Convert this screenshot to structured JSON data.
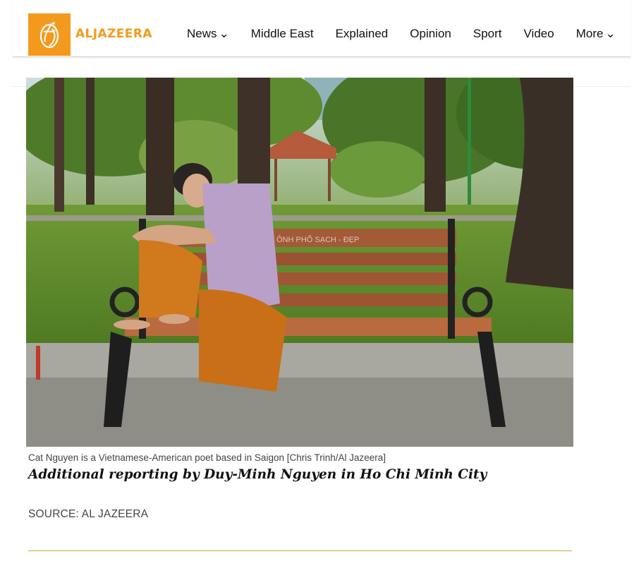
{
  "header": {
    "logo_text": "ALJAZEERA",
    "logo_icon": "aljazeera-calligraphy-icon",
    "brand_color": "#f39a1e",
    "nav": [
      {
        "label": "News",
        "has_dropdown": true
      },
      {
        "label": "Middle East",
        "has_dropdown": false
      },
      {
        "label": "Explained",
        "has_dropdown": false
      },
      {
        "label": "Opinion",
        "has_dropdown": false
      },
      {
        "label": "Sport",
        "has_dropdown": false
      },
      {
        "label": "Video",
        "has_dropdown": false
      },
      {
        "label": "More",
        "has_dropdown": true
      }
    ],
    "chevron": "⌄"
  },
  "article": {
    "bench_sign": "ÔNH PHỐ SẠCH - ĐẸP",
    "caption": "Cat Nguyen is a Vietnamese-American poet based in Saigon [Chris Trinh/Al Jazeera]",
    "reporting": "Additional reporting by Duy-Minh Nguyen in Ho Chi Minh City",
    "source": "SOURCE: AL JAZEERA",
    "divider_color": "#d5a23a"
  }
}
